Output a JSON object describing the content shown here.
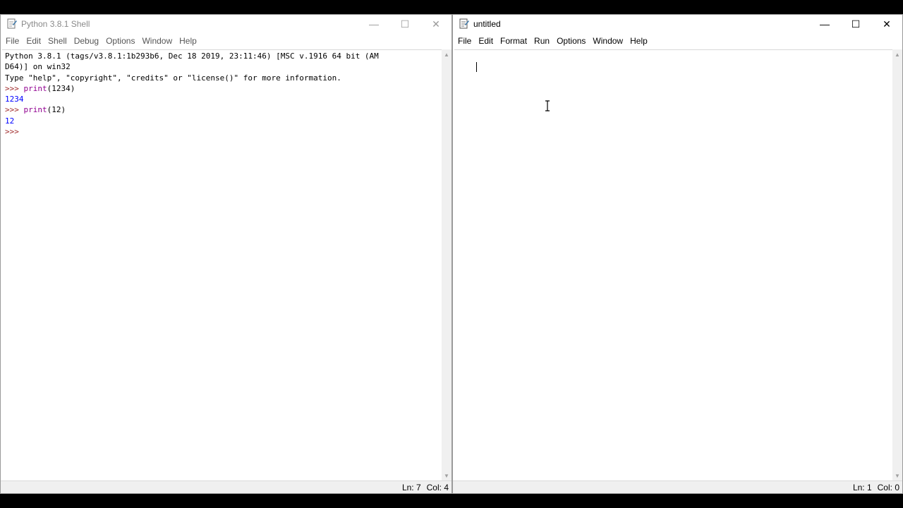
{
  "shell": {
    "title": "Python 3.8.1 Shell",
    "menu": [
      "File",
      "Edit",
      "Shell",
      "Debug",
      "Options",
      "Window",
      "Help"
    ],
    "lines": [
      {
        "parts": [
          {
            "cls": "c-normal",
            "text": "Python 3.8.1 (tags/v3.8.1:1b293b6, Dec 18 2019, 23:11:46) [MSC v.1916 64 bit (AM"
          }
        ]
      },
      {
        "parts": [
          {
            "cls": "c-normal",
            "text": "D64)] on win32"
          }
        ]
      },
      {
        "parts": [
          {
            "cls": "c-normal",
            "text": "Type \"help\", \"copyright\", \"credits\" or \"license()\" for more information."
          }
        ]
      },
      {
        "parts": [
          {
            "cls": "c-prompt",
            "text": ">>> "
          },
          {
            "cls": "c-builtin",
            "text": "print"
          },
          {
            "cls": "c-normal",
            "text": "(1234)"
          }
        ]
      },
      {
        "parts": [
          {
            "cls": "c-output",
            "text": "1234"
          }
        ]
      },
      {
        "parts": [
          {
            "cls": "c-prompt",
            "text": ">>> "
          },
          {
            "cls": "c-builtin",
            "text": "print"
          },
          {
            "cls": "c-normal",
            "text": "(12)"
          }
        ]
      },
      {
        "parts": [
          {
            "cls": "c-output",
            "text": "12"
          }
        ]
      },
      {
        "parts": [
          {
            "cls": "c-prompt",
            "text": ">>> "
          }
        ]
      }
    ],
    "status": {
      "ln": "Ln: 7",
      "col": "Col: 4"
    }
  },
  "editor": {
    "title": "untitled",
    "menu": [
      "File",
      "Edit",
      "Format",
      "Run",
      "Options",
      "Window",
      "Help"
    ],
    "status": {
      "ln": "Ln: 1",
      "col": "Col: 0"
    }
  },
  "icons": {
    "python": "python-idle-icon",
    "minimize": "minimize-icon",
    "maximize": "maximize-icon",
    "close": "close-icon",
    "mouse": "ibeam-cursor-icon"
  },
  "colors": {
    "prompt": "#a02b2b",
    "output": "#0000ff",
    "builtin": "#900090"
  }
}
